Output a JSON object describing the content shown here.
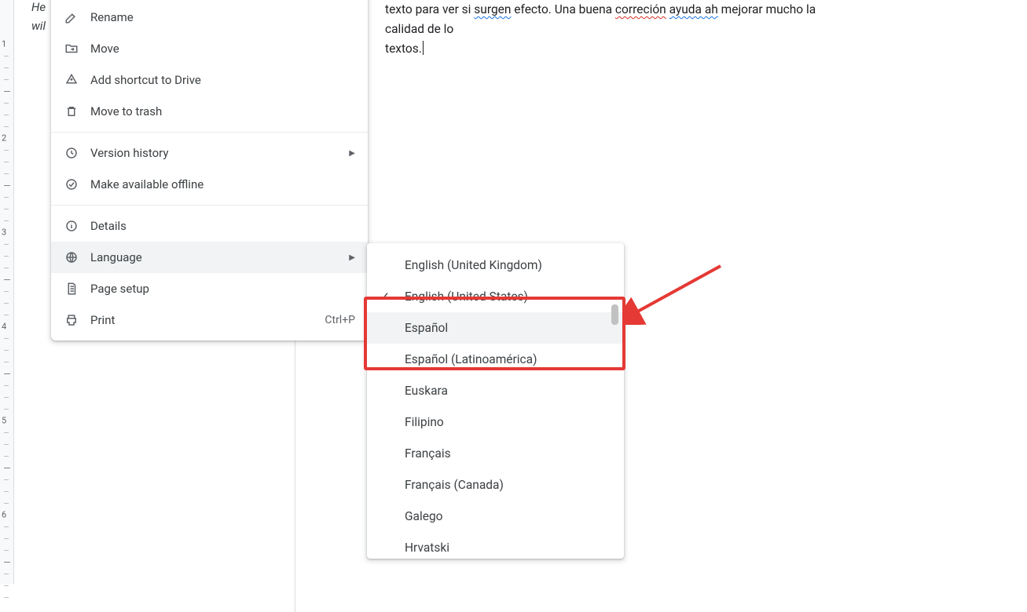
{
  "ruler": {
    "numbers": [
      "1",
      "2",
      "3",
      "4",
      "5",
      "6"
    ]
  },
  "peek": {
    "line1": "He",
    "line2": "wil"
  },
  "doc": {
    "frag1": "texto para ver si ",
    "u1": "surgen",
    "frag2": " efecto. Una buena ",
    "u2": "correción",
    "frag3": " ",
    "u3": "ayuda ah",
    "frag4": " mejorar mucho la calidad de lo",
    "line2": "textos."
  },
  "menu": {
    "rename": "Rename",
    "move": "Move",
    "addShortcut": "Add shortcut to Drive",
    "trash": "Move to trash",
    "versionHistory": "Version history",
    "offline": "Make available offline",
    "details": "Details",
    "language": "Language",
    "pageSetup": "Page setup",
    "print": "Print",
    "printShortcut": "Ctrl+P"
  },
  "languages": {
    "en_gb": "English (United Kingdom)",
    "en_us": "English (United States)",
    "es": "Español",
    "es_la": "Español (Latinoamérica)",
    "eu": "Euskara",
    "fil": "Filipino",
    "fr": "Français",
    "fr_ca": "Français (Canada)",
    "gl": "Galego",
    "hr": "Hrvatski"
  }
}
